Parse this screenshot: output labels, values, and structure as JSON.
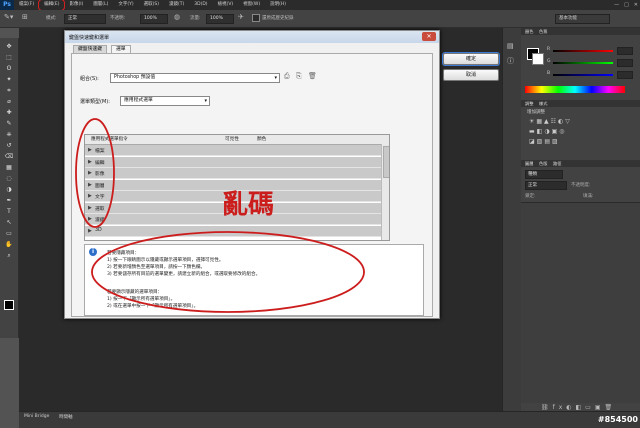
{
  "menubar": {
    "logo": "Ps",
    "items": [
      "檔案(F)",
      "編輯(E)",
      "影像(I)",
      "圖層(L)",
      "文字(Y)",
      "選取(S)",
      "濾鏡(T)",
      "3D(D)",
      "檢視(V)",
      "視窗(W)",
      "說明(H)"
    ],
    "window_controls": [
      "—",
      "□",
      "✕"
    ]
  },
  "optbar": {
    "label_mode": "模式:",
    "value_mode": "正常",
    "label_opacity": "不透明:",
    "value_opacity": "100%",
    "label_flow": "流量:",
    "value_flow": "100%",
    "checkbox_label": "還原成歷史紀錄",
    "workspace": "基本功能"
  },
  "annotation_menu": "選取",
  "dialog": {
    "title": "鍵盤快速鍵和選單",
    "close": "✕",
    "tabs": [
      "鍵盤快速鍵",
      "選單"
    ],
    "set_label": "組合(S):",
    "set_value": "Photoshop 預設值",
    "for_label": "選單類型(M):",
    "for_value": "應用程式選單",
    "table_headers": [
      "應用程式選單指令",
      "可見性",
      "顏色"
    ],
    "rows": [
      "檔案",
      "編輯",
      "影像",
      "圖層",
      "文字",
      "選取",
      "濾鏡",
      "3D"
    ],
    "info_lines": [
      "若要隱藏項目：",
      "1) 按一下眼睛圖示以隱藏或顯示選單項目，選擇可見性。",
      "2) 若要新增顏色至選單項目，請按一下顏色欄。",
      "3) 若要儲存所有目前的選單變更，請建立新的組合，或選取要修改的組合。",
      "若要顯示隱藏的選單項目：",
      "1) 按一下「顯示所有選單項目」。",
      "2) 或在選單中按一下「顯示所有選單項目」。"
    ],
    "ok": "確定",
    "cancel": "取消"
  },
  "garbled_annotation": "亂碼",
  "toolbar_icons": [
    "move-icon",
    "marquee-icon",
    "lasso-icon",
    "quick-select-icon",
    "crop-icon",
    "eyedropper-icon",
    "healing-icon",
    "brush-icon",
    "stamp-icon",
    "history-brush-icon",
    "eraser-icon",
    "gradient-icon",
    "blur-icon",
    "dodge-icon",
    "pen-icon",
    "type-icon",
    "path-select-icon",
    "shape-icon",
    "hand-icon",
    "zoom-icon"
  ],
  "panels": {
    "color_tabs": [
      "顏色",
      "色票"
    ],
    "adjust_tabs": [
      "調整",
      "樣式"
    ],
    "adjust_title": "增加調整",
    "layers_tabs": [
      "圖層",
      "色版",
      "路徑"
    ],
    "kind_label": "種類",
    "blend_value": "正常",
    "opacity_label": "不透明度:",
    "lock_label": "鎖定:",
    "fill_label": "填滿:"
  },
  "bottom_tabs": [
    "Mini Bridge",
    "時間軸"
  ],
  "watermark": "#854500",
  "colors": {
    "accent_red": "#cc1d1d",
    "ps_blue": "#4fa3ff"
  }
}
